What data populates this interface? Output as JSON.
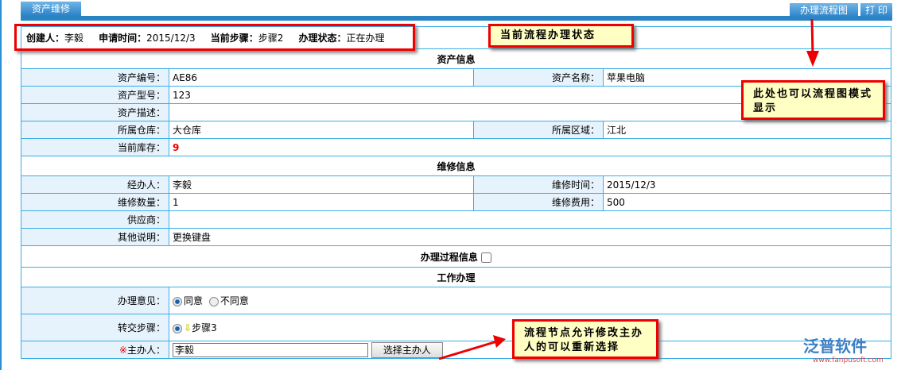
{
  "tab_title": "资产维修",
  "toolbar": {
    "flow_btn": "办理流程图",
    "print_btn": "打 印"
  },
  "summary": {
    "creator_label": "创建人：",
    "creator": "李毅",
    "date_label": "申请时间：",
    "date": "2015/12/3",
    "step_label": "当前步骤：",
    "step": "步骤2",
    "status_label": "办理状态：",
    "status": "正在办理"
  },
  "asset": {
    "title": "资产信息",
    "code_label": "资产编号：",
    "code": "AE86",
    "name_label": "资产名称：",
    "name": "苹果电脑",
    "model_label": "资产型号：",
    "model": "123",
    "desc_label": "资产描述：",
    "desc": "",
    "warehouse_label": "所属仓库：",
    "warehouse": "大仓库",
    "area_label": "所属区域：",
    "area": "江北",
    "stock_label": "当前库存：",
    "stock": "9"
  },
  "repair": {
    "title": "维修信息",
    "handler_label": "经办人：",
    "handler": "李毅",
    "time_label": "维修时间：",
    "time": "2015/12/3",
    "qty_label": "维修数量：",
    "qty": "1",
    "cost_label": "维修费用：",
    "cost": "500",
    "supplier_label": "供应商：",
    "supplier": "",
    "other_label": "其他说明：",
    "other": "更换键盘"
  },
  "process": {
    "title": "办理过程信息"
  },
  "work": {
    "title": "工作办理",
    "opinion_label": "办理意见：",
    "agree": "同意",
    "disagree": "不同意",
    "next_label": "转交步骤：",
    "next_step": "步骤3",
    "owner_mark": "※",
    "owner_label": "主办人：",
    "owner_value": "李毅",
    "select_btn": "选择主办人"
  },
  "callouts": {
    "c1": "当前流程办理状态",
    "c2": "此处也可以流程图模式显示",
    "c3": "流程节点允许修改主办人的可以重新选择"
  },
  "logo": {
    "name": "泛普软件",
    "url": "www.fanpusoft.com"
  }
}
